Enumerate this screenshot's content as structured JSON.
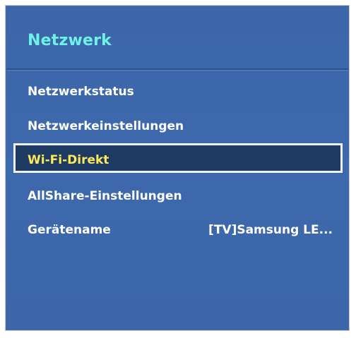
{
  "menu": {
    "title": "Netzwerk",
    "items": [
      {
        "label": "Netzwerkstatus"
      },
      {
        "label": "Netzwerkeinstellungen"
      },
      {
        "label": "Wi-Fi-Direkt"
      },
      {
        "label": "AllShare-Einstellungen"
      },
      {
        "label": "Gerätename",
        "value": "[TV]Samsung LE..."
      }
    ],
    "selected_label": "Wi-Fi-Direkt"
  },
  "colors": {
    "panel_background": "#3d69ad",
    "title_color": "#6ef2e6",
    "selected_text": "#ffe85a",
    "selected_background": "#1d3a63",
    "item_text": "#ffffff"
  }
}
